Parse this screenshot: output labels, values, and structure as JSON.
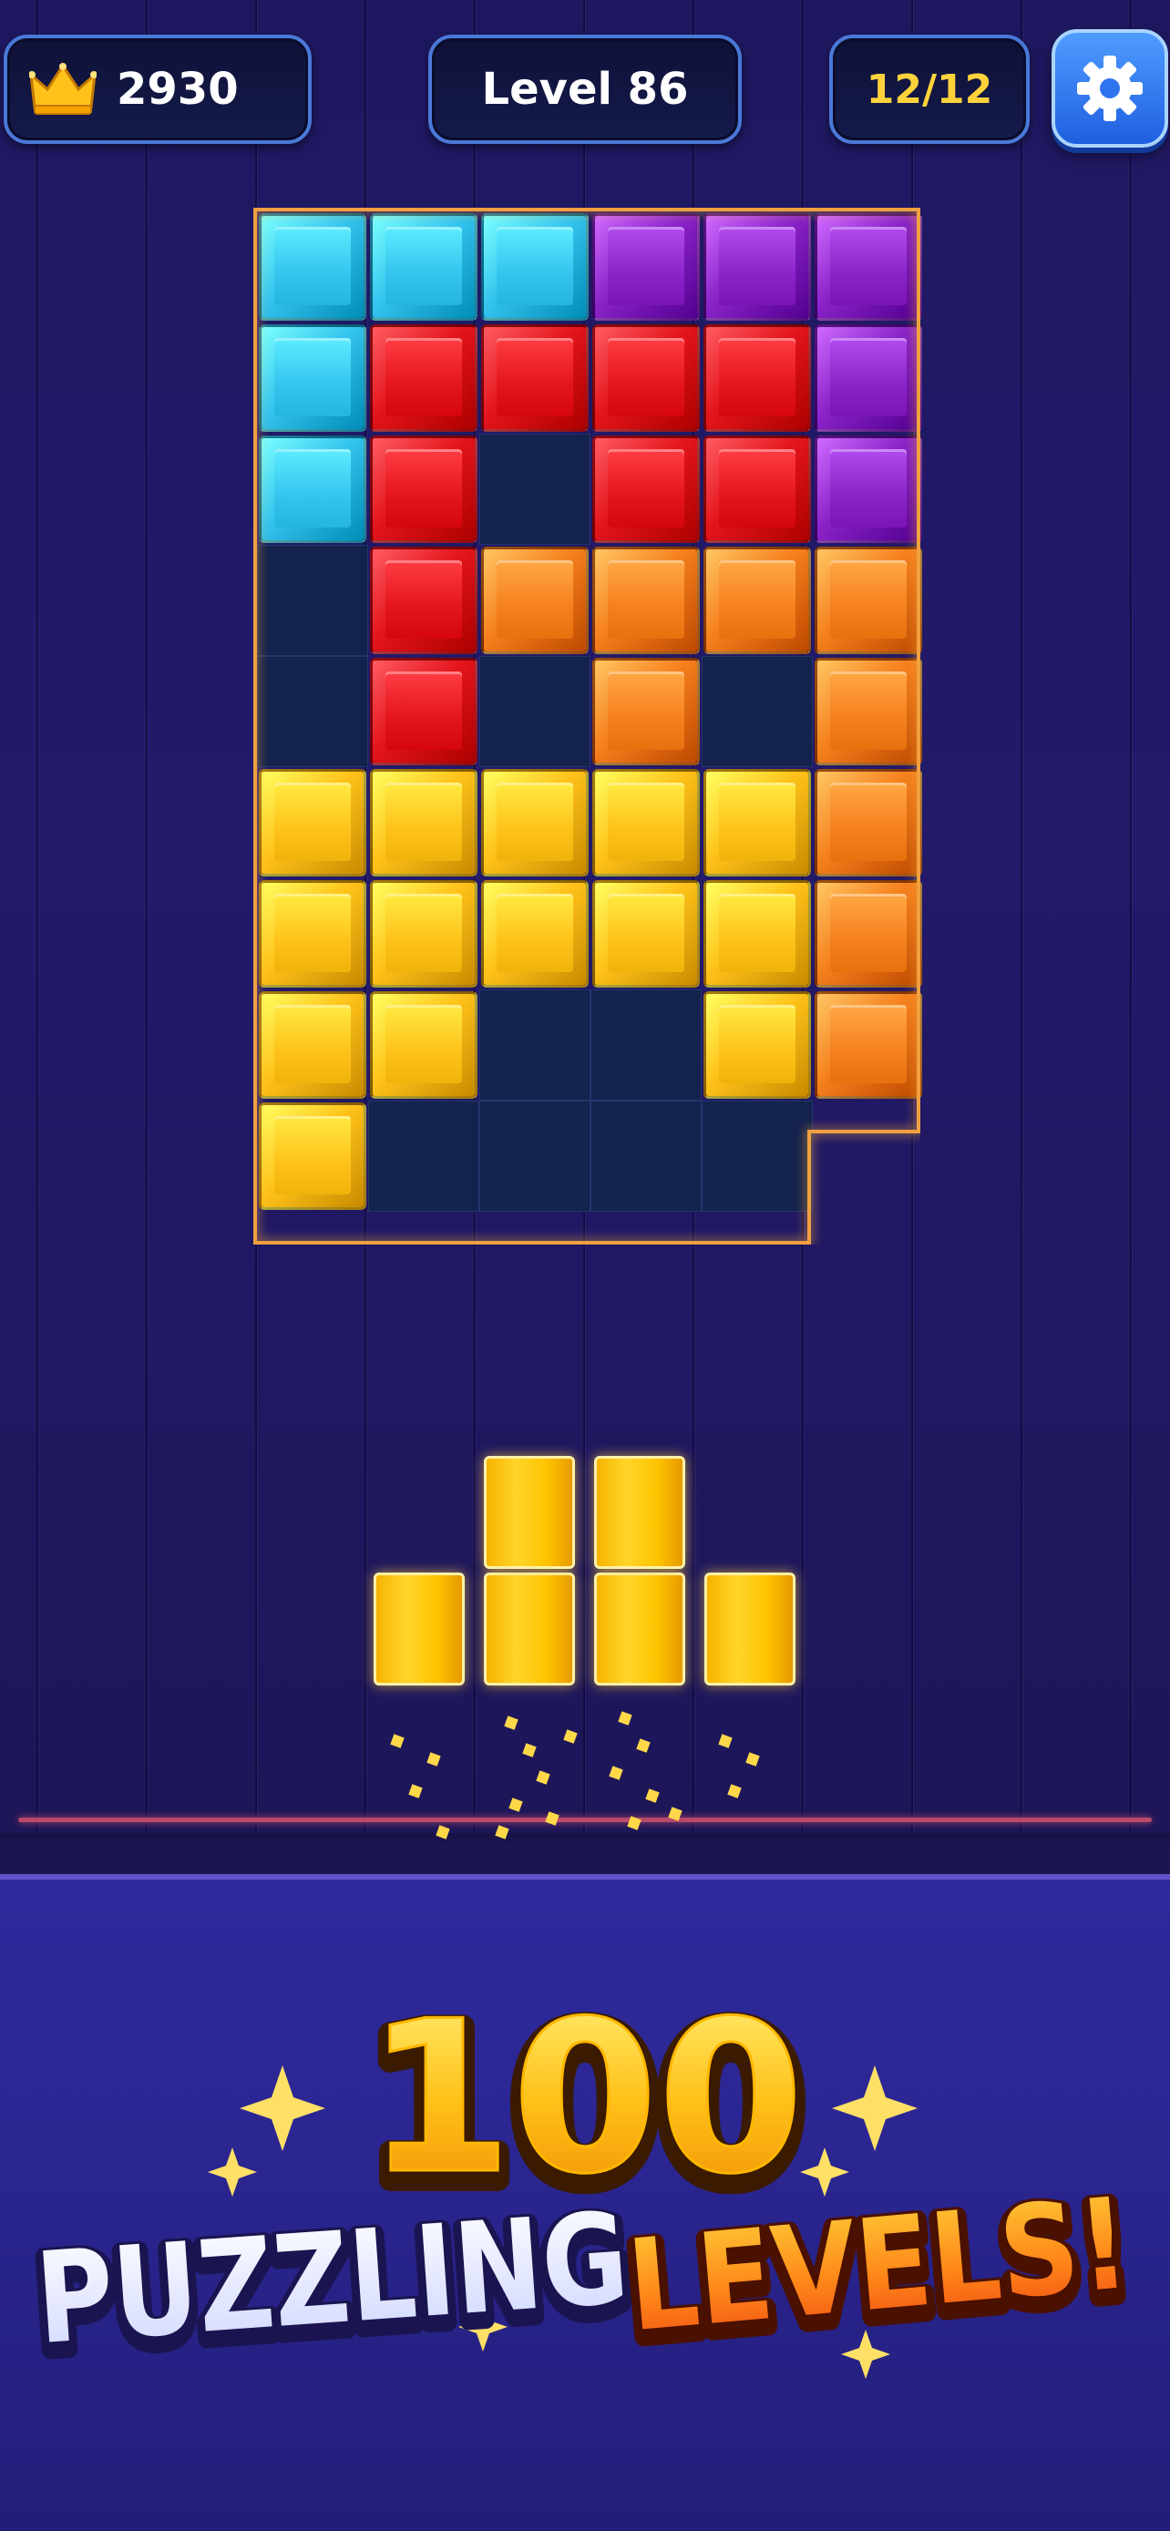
{
  "hud": {
    "score": "2930",
    "level": "Level 86",
    "moves": "12/12",
    "score_icon": "crown-icon",
    "settings_icon": "gear-icon"
  },
  "board": {
    "columns": 6,
    "rows": 9,
    "colors": {
      "C": "#35c4ee",
      "P": "#8a23c8",
      "R": "#e4151c",
      "O": "#f5801d",
      "Y": "#ffc21a"
    },
    "grid": [
      "CCCPPP",
      "CRRRRP",
      "CR.RRP",
      ".ROOOO",
      ".R.O.O",
      "YYYYYO",
      "YYYYYO",
      "YY..YO",
      "Y....x"
    ]
  },
  "tray": {
    "piece_color": "#ffc21a",
    "columns_heights": [
      1,
      2,
      2,
      1
    ]
  },
  "promo": {
    "number": "100",
    "word1": "PUZZLING",
    "word2": "LEVELS!"
  }
}
